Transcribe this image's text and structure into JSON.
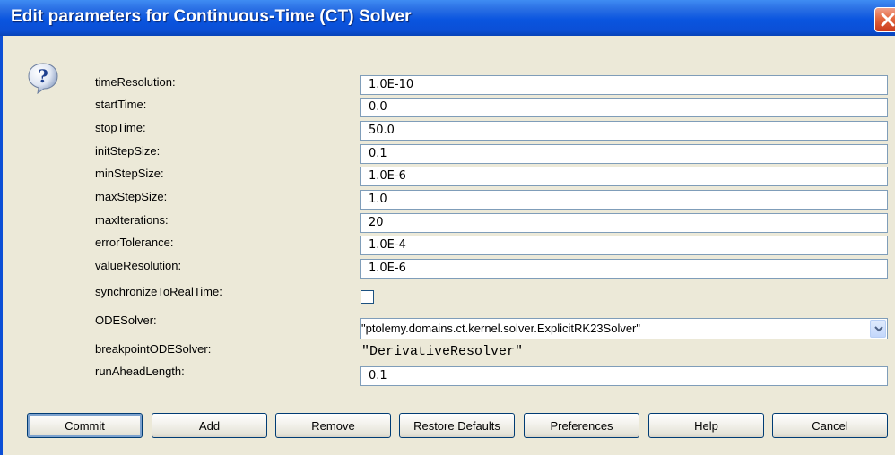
{
  "window": {
    "title": "Edit parameters for Continuous-Time (CT) Solver"
  },
  "icons": {
    "dialog": "question-icon",
    "close": "close-icon",
    "dropdown": "chevron-down-icon"
  },
  "params": [
    {
      "label": "timeResolution:",
      "value": "1.0E-10"
    },
    {
      "label": "startTime:",
      "value": "0.0"
    },
    {
      "label": "stopTime:",
      "value": "50.0"
    },
    {
      "label": "initStepSize:",
      "value": "0.1"
    },
    {
      "label": "minStepSize:",
      "value": "1.0E-6"
    },
    {
      "label": "maxStepSize:",
      "value": "1.0"
    },
    {
      "label": "maxIterations:",
      "value": "20"
    },
    {
      "label": "errorTolerance:",
      "value": "1.0E-4"
    },
    {
      "label": "valueResolution:",
      "value": "1.0E-6"
    }
  ],
  "synchronize": {
    "label": "synchronizeToRealTime:",
    "checked": false
  },
  "odesolver": {
    "label": "ODESolver:",
    "value": "\"ptolemy.domains.ct.kernel.solver.ExplicitRK23Solver\""
  },
  "breakpoint": {
    "label": "breakpointODESolver:",
    "value": "\"DerivativeResolver\""
  },
  "runahead": {
    "label": "runAheadLength:",
    "value": "0.1"
  },
  "buttons": {
    "commit": "Commit",
    "add": "Add",
    "remove": "Remove",
    "restore": "Restore Defaults",
    "preferences": "Preferences",
    "help": "Help",
    "cancel": "Cancel"
  },
  "colors": {
    "titlebar": "#0b4fd6",
    "dialog_bg": "#ece9d8",
    "field_border": "#7f9db9",
    "close": "#d94a22"
  }
}
